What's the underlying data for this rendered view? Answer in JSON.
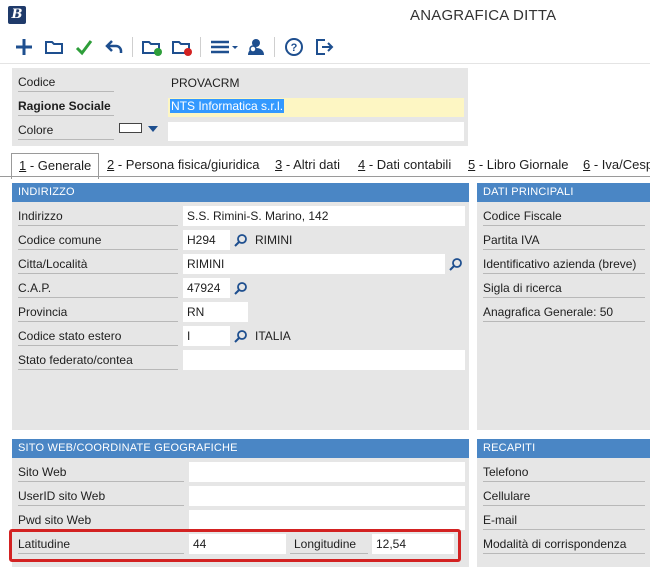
{
  "window": {
    "title": "ANAGRAFICA DITTA",
    "logo_letter": "B"
  },
  "toolbar": {
    "buttons": [
      "plus-icon",
      "open-folder-icon",
      "check-icon",
      "undo-icon",
      "folder-green-icon",
      "folder-red-icon",
      "menu-icon",
      "user-search-icon",
      "help-icon",
      "exit-icon"
    ]
  },
  "header": {
    "codice_label": "Codice",
    "codice_value": "PROVACRM",
    "ragione_label": "Ragione Sociale",
    "ragione_value": "NTS Informatica s.r.l.",
    "colore_label": "Colore"
  },
  "tabs": [
    {
      "num": "1",
      "label": " - Generale"
    },
    {
      "num": "2",
      "label": " - Persona fisica/giuridica"
    },
    {
      "num": "3",
      "label": " - Altri dati"
    },
    {
      "num": "4",
      "label": " - Dati contabili"
    },
    {
      "num": "5",
      "label": " - Libro Giornale"
    },
    {
      "num": "6",
      "label": " - Iva/Cesp"
    }
  ],
  "indirizzo": {
    "title": "INDIRIZZO",
    "indirizzo_label": "Indirizzo",
    "indirizzo_value": "S.S. Rimini-S. Marino, 142",
    "codice_comune_label": "Codice comune",
    "codice_comune_value": "H294",
    "comune_name": "RIMINI",
    "citta_label": "Citta/Località",
    "citta_value": "RIMINI",
    "cap_label": "C.A.P.",
    "cap_value": "47924",
    "provincia_label": "Provincia",
    "provincia_value": "RN",
    "stato_estero_label": "Codice stato estero",
    "stato_estero_value": "I",
    "stato_estero_name": "ITALIA",
    "stato_federato_label": "Stato federato/contea",
    "stato_federato_value": ""
  },
  "dati_principali": {
    "title": "DATI PRINCIPALI",
    "codice_fiscale_label": "Codice Fiscale",
    "partita_iva_label": "Partita IVA",
    "identificativo_label": "Identificativo azienda (breve)",
    "sigla_label": "Sigla di ricerca",
    "anagrafica_label": "Anagrafica Generale: 50"
  },
  "sito_web": {
    "title": "SITO WEB/COORDINATE GEOGRAFICHE",
    "sito_label": "Sito Web",
    "sito_value": "",
    "userid_label": "UserID sito Web",
    "userid_value": "",
    "pwd_label": "Pwd sito Web",
    "pwd_value": "",
    "latitudine_label": "Latitudine",
    "latitudine_value": "44",
    "longitudine_label": "Longitudine",
    "longitudine_value": "12,54"
  },
  "recapiti": {
    "title": "RECAPITI",
    "telefono_label": "Telefono",
    "cellulare_label": "Cellulare",
    "email_label": "E-mail",
    "modalita_label": "Modalità di corrispondenza"
  },
  "colors": {
    "section_header": "#4a86c5",
    "panel_bg": "#e6e6e6",
    "highlight": "#d32222",
    "selected_text_bg": "#3399ff",
    "required_field_bg": "#fdf6c3"
  }
}
